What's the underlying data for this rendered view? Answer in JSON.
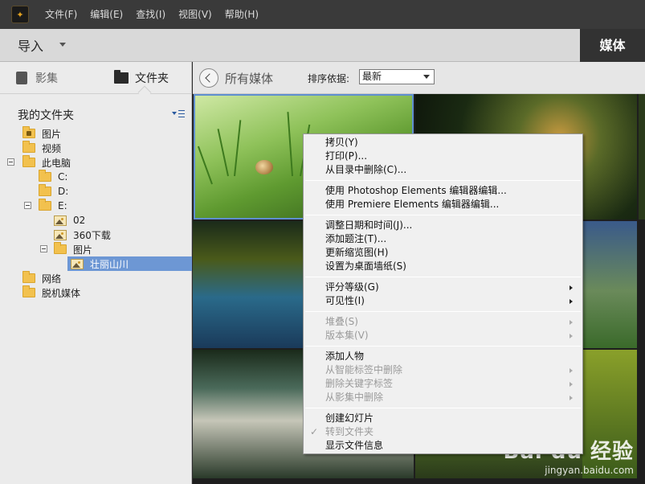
{
  "menubar": {
    "items": [
      "文件(F)",
      "编辑(E)",
      "查找(I)",
      "视图(V)",
      "帮助(H)"
    ]
  },
  "toolbar": {
    "import_label": "导入",
    "media_tab": "媒体"
  },
  "left_panel": {
    "tabs": [
      {
        "label": "影集",
        "icon": "album-icon",
        "active": false
      },
      {
        "label": "文件夹",
        "icon": "folder-icon",
        "active": true
      }
    ],
    "my_folders_title": "我的文件夹",
    "tree": [
      {
        "label": "图片",
        "icon": "special-folder-icon",
        "level": 0
      },
      {
        "label": "视频",
        "icon": "folder-icon",
        "level": 0
      },
      {
        "label": "此电脑",
        "icon": "folder-icon",
        "level": 0,
        "expanded": true
      },
      {
        "label": "C:",
        "icon": "folder-icon",
        "level": 1
      },
      {
        "label": "D:",
        "icon": "folder-icon",
        "level": 1
      },
      {
        "label": "E:",
        "icon": "folder-icon",
        "level": 1,
        "expanded": true
      },
      {
        "label": "02",
        "icon": "image-folder-icon",
        "level": 2
      },
      {
        "label": "360下载",
        "icon": "image-folder-icon",
        "level": 2
      },
      {
        "label": "图片",
        "icon": "folder-icon",
        "level": 2,
        "expanded": true
      },
      {
        "label": "壮丽山川",
        "icon": "image-folder-icon",
        "level": 3,
        "selected": true
      },
      {
        "label": "网络",
        "icon": "folder-icon",
        "level": 0
      },
      {
        "label": "脱机媒体",
        "icon": "folder-icon",
        "level": 0
      }
    ]
  },
  "main": {
    "breadcrumb": "所有媒体",
    "sort_label": "排序依据:",
    "sort_value": "最新"
  },
  "context_menu": {
    "items": [
      {
        "label": "拷贝(Y)",
        "enabled": true
      },
      {
        "label": "打印(P)...",
        "enabled": true
      },
      {
        "label": "从目录中删除(C)...",
        "enabled": true
      },
      {
        "label": "使用 Photoshop Elements 编辑器编辑...",
        "enabled": true
      },
      {
        "label": "使用 Premiere Elements 编辑器编辑...",
        "enabled": true
      },
      {
        "label": "调整日期和时间(J)...",
        "enabled": true
      },
      {
        "label": "添加题注(T)...",
        "enabled": true
      },
      {
        "label": "更新缩览图(H)",
        "enabled": true
      },
      {
        "label": "设置为桌面墙纸(S)",
        "enabled": true
      },
      {
        "label": "评分等级(G)",
        "enabled": true,
        "submenu": true
      },
      {
        "label": "可见性(I)",
        "enabled": true,
        "submenu": true
      },
      {
        "label": "堆叠(S)",
        "enabled": false,
        "submenu": true
      },
      {
        "label": "版本集(V)",
        "enabled": false,
        "submenu": true
      },
      {
        "label": "添加人物",
        "enabled": true
      },
      {
        "label": "从智能标签中删除",
        "enabled": false,
        "submenu": true
      },
      {
        "label": "删除关键字标签",
        "enabled": false,
        "submenu": true
      },
      {
        "label": "从影集中删除",
        "enabled": false,
        "submenu": true
      },
      {
        "label": "创建幻灯片",
        "enabled": true
      },
      {
        "label": "转到文件夹",
        "enabled": false,
        "checked": true
      },
      {
        "label": "显示文件信息",
        "enabled": true
      }
    ]
  },
  "watermark": {
    "logo_text": "Bai du 经验",
    "url": "jingyan.baidu.com"
  }
}
